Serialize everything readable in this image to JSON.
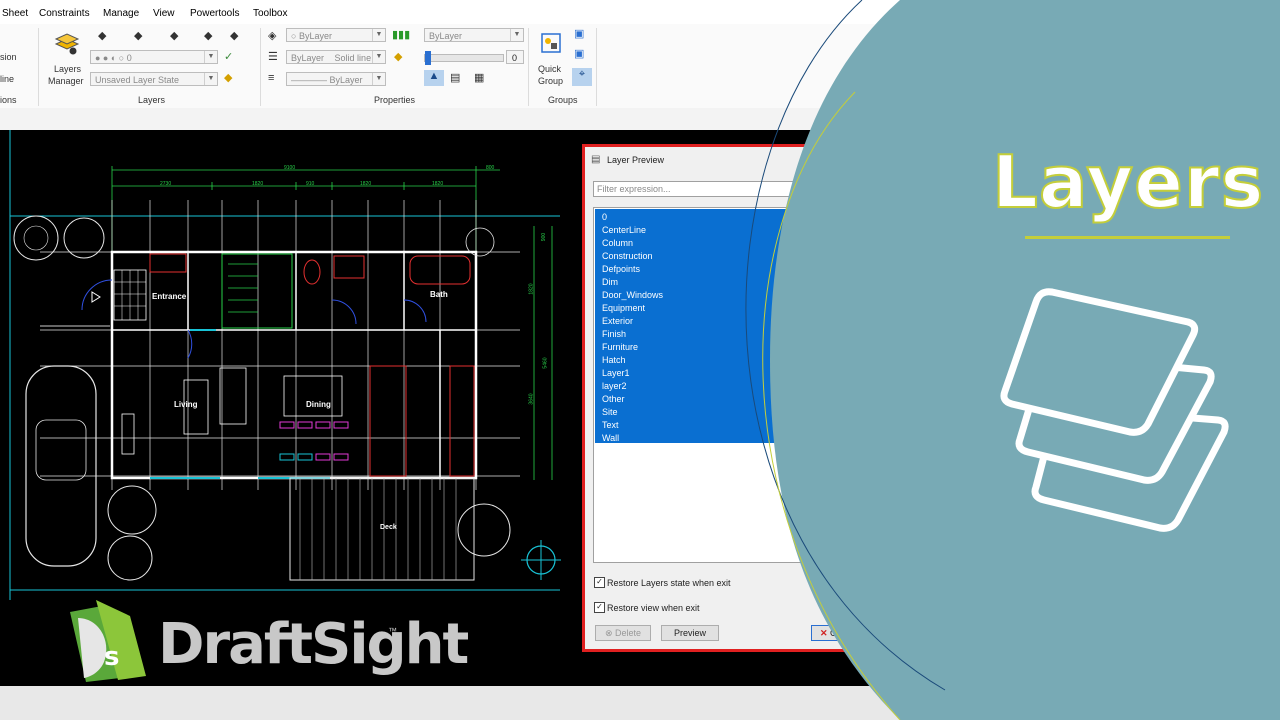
{
  "menu": [
    "Sheet",
    "Constraints",
    "Manage",
    "View",
    "Powertools",
    "Toolbox"
  ],
  "ribbon": {
    "left_partial": [
      "sion",
      "line",
      "ions"
    ],
    "layers_manager": [
      "Layers",
      "Manager"
    ],
    "layer_combo": "0",
    "layer_state": "Unsaved Layer State",
    "layers_group": "Layers",
    "color_combo": "ByLayer",
    "linestyle_combo": "ByLayer",
    "linestyle_value": "Solid line",
    "lineweight_combo": "ByLayer",
    "transparency_combo": "ByLayer",
    "transparency_value": "0",
    "properties_group": "Properties",
    "quick_group": [
      "Quick",
      "Group"
    ],
    "groups_group": "Groups"
  },
  "drawing": {
    "rooms": [
      "Entrance",
      "Bath",
      "Living",
      "Dining",
      "Deck"
    ],
    "dims": [
      "9100",
      "2730",
      "1820",
      "910",
      "1820",
      "1820",
      "800",
      "900",
      "1820",
      "3640",
      "5460"
    ]
  },
  "dialog": {
    "title": "Layer Preview",
    "filter_placeholder": "Filter expression...",
    "layers": [
      "0",
      "CenterLine",
      "Column",
      "Construction",
      "Defpoints",
      "Dim",
      "Door_Windows",
      "Equipment",
      "Exterior",
      "Finish",
      "Furniture",
      "Hatch",
      "Layer1",
      "layer2",
      "Other",
      "Site",
      "Text",
      "Wall"
    ],
    "restore_layers": "Restore Layers state when exit",
    "restore_view": "Restore view when exit",
    "delete": "Delete",
    "preview": "Preview",
    "close": "Clos"
  },
  "banner": {
    "title": "Layers",
    "logo_text": "DraftSight",
    "logo_tm": "™",
    "bg_color": "#78aab5",
    "accent": "#c4ce3a"
  }
}
